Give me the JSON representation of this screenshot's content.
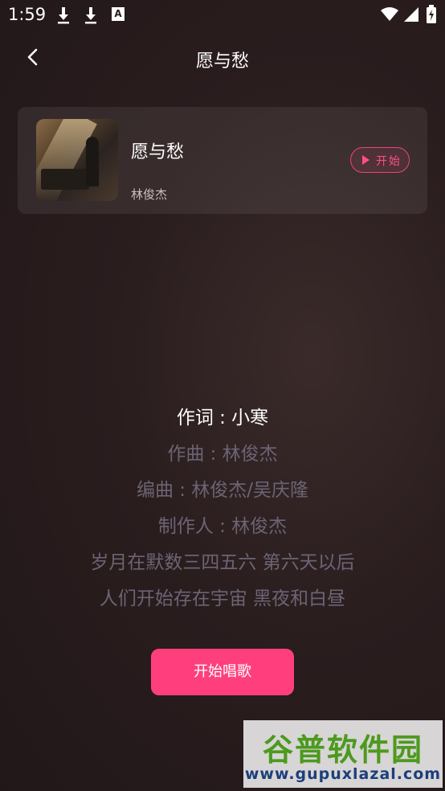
{
  "status_bar": {
    "time": "1:59",
    "a_badge": "A",
    "icons": [
      "download-icon",
      "download-icon",
      "a-icon",
      "wifi-icon",
      "signal-icon",
      "battery-icon"
    ]
  },
  "nav": {
    "title": "愿与愁",
    "back_icon": "chevron-left-icon"
  },
  "song": {
    "name": "愿与愁",
    "artist": "林俊杰",
    "start_label": "开始"
  },
  "lyrics": [
    {
      "text": "作词 : 小寒",
      "active": true
    },
    {
      "text": "作曲 : 林俊杰",
      "active": false
    },
    {
      "text": "编曲 : 林俊杰/吴庆隆",
      "active": false
    },
    {
      "text": "制作人 : 林俊杰",
      "active": false
    },
    {
      "text": "岁月在默数三四五六 第六天以后",
      "active": false
    },
    {
      "text": "人们开始存在宇宙 黑夜和白昼",
      "active": false
    }
  ],
  "sing_button": {
    "label": "开始唱歌"
  },
  "watermark": {
    "title": "谷普软件园",
    "url": "www.gupuxlazal.com"
  },
  "colors": {
    "accent": "#ff3f7d",
    "lyric_active": "#ffffff",
    "lyric_inactive": "#6b6474"
  }
}
